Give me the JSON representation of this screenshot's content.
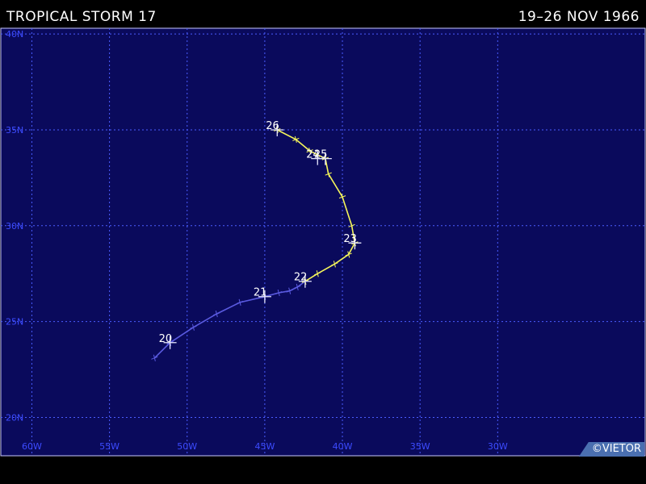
{
  "header": {
    "title": "TROPICAL STORM 17",
    "dates": "19–26 NOV 1966"
  },
  "copyright": "©VIETOR",
  "map": {
    "projection": "lat-lon",
    "lon_range": [
      -62,
      -20.5
    ],
    "lat_range": [
      18.0,
      40.3
    ],
    "grid": true,
    "lon_ticks": [
      {
        "value": -60,
        "label": "60W"
      },
      {
        "value": -55,
        "label": "55W"
      },
      {
        "value": -50,
        "label": "50W"
      },
      {
        "value": -45,
        "label": "45W"
      },
      {
        "value": -40,
        "label": "40W"
      },
      {
        "value": -35,
        "label": "35W"
      },
      {
        "value": -30,
        "label": "30W"
      }
    ],
    "lat_ticks": [
      {
        "value": 20,
        "label": "20N"
      },
      {
        "value": 25,
        "label": "25N"
      },
      {
        "value": 30,
        "label": "30N"
      },
      {
        "value": 35,
        "label": "35N"
      },
      {
        "value": 40,
        "label": "40N"
      }
    ],
    "colors": {
      "background": "#0a0a5c",
      "grid": "#4a5cff",
      "depression_track": "#5a5ae0",
      "storm_track": "#f5f55a"
    }
  },
  "chart_data": {
    "type": "line",
    "series": [
      {
        "intensity": "depression",
        "color": "#5a5ae0",
        "points": [
          {
            "lat": 23.1,
            "lon": -52.1
          },
          {
            "lat": 23.9,
            "lon": -51.1
          },
          {
            "lat": 24.7,
            "lon": -49.6
          },
          {
            "lat": 25.4,
            "lon": -48.1
          },
          {
            "lat": 26.0,
            "lon": -46.6
          },
          {
            "lat": 26.3,
            "lon": -45.0
          },
          {
            "lat": 26.5,
            "lon": -44.1
          },
          {
            "lat": 26.6,
            "lon": -43.4
          },
          {
            "lat": 26.8,
            "lon": -42.9
          },
          {
            "lat": 27.1,
            "lon": -42.4
          }
        ]
      },
      {
        "intensity": "storm",
        "color": "#f5f55a",
        "points": [
          {
            "lat": 27.1,
            "lon": -42.4
          },
          {
            "lat": 27.5,
            "lon": -41.6
          },
          {
            "lat": 28.0,
            "lon": -40.5
          },
          {
            "lat": 28.5,
            "lon": -39.6
          },
          {
            "lat": 29.1,
            "lon": -39.2
          },
          {
            "lat": 30.0,
            "lon": -39.4
          },
          {
            "lat": 31.5,
            "lon": -40.0
          },
          {
            "lat": 32.7,
            "lon": -40.9
          },
          {
            "lat": 33.5,
            "lon": -41.1
          },
          {
            "lat": 33.9,
            "lon": -42.1
          },
          {
            "lat": 34.5,
            "lon": -43.0
          },
          {
            "lat": 35.0,
            "lon": -44.2
          }
        ]
      }
    ],
    "day_markers": [
      {
        "label": "20",
        "lat": 23.9,
        "lon": -51.1
      },
      {
        "label": "21",
        "lat": 26.3,
        "lon": -45.0
      },
      {
        "label": "22",
        "lat": 27.1,
        "lon": -42.4
      },
      {
        "label": "23",
        "lat": 29.1,
        "lon": -39.2
      },
      {
        "label": "24",
        "lat": 33.5,
        "lon": -41.6
      },
      {
        "label": "25",
        "lat": 33.5,
        "lon": -41.1
      },
      {
        "label": "26",
        "lat": 35.0,
        "lon": -44.2
      }
    ]
  }
}
